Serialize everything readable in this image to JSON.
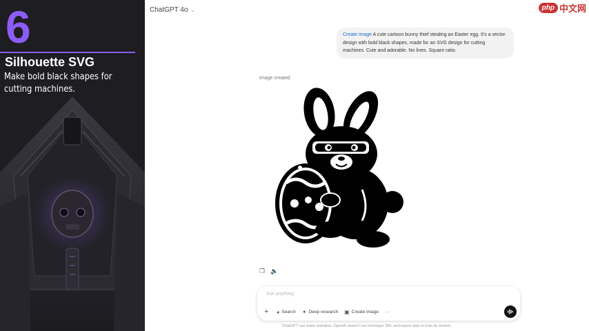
{
  "left_panel": {
    "number": "6",
    "title": "Silhouette SVG",
    "subtitle": "Make bold black shapes for cutting machines."
  },
  "header": {
    "model_label": "ChatGPT 4o",
    "watermark_php": "php",
    "watermark_cn": "中文网"
  },
  "chat": {
    "user_message_link": "Create image",
    "user_message_text": " A cute cartoon bunny thief stealing an Easter egg. It's a vector design with bold black shapes, made for an SVG design for cutting machines. Cute and adorable. No lines. Square ratio.",
    "image_created_label": "Image created"
  },
  "composer": {
    "placeholder": "Ask anything",
    "tools": [
      {
        "label": "Search",
        "icon": "globe-icon"
      },
      {
        "label": "Deep research",
        "icon": "telescope-icon"
      },
      {
        "label": "Create image",
        "icon": "image-icon"
      }
    ],
    "more_label": "···"
  },
  "footer": {
    "disclaimer": "ChatGPT can make mistakes. OpenAI doesn't use Hostinger SRL workspace data to train its models."
  },
  "colors": {
    "accent_purple": "#8b5cf6",
    "link_blue": "#1a6fd6",
    "left_bg": "#1e1d22"
  }
}
